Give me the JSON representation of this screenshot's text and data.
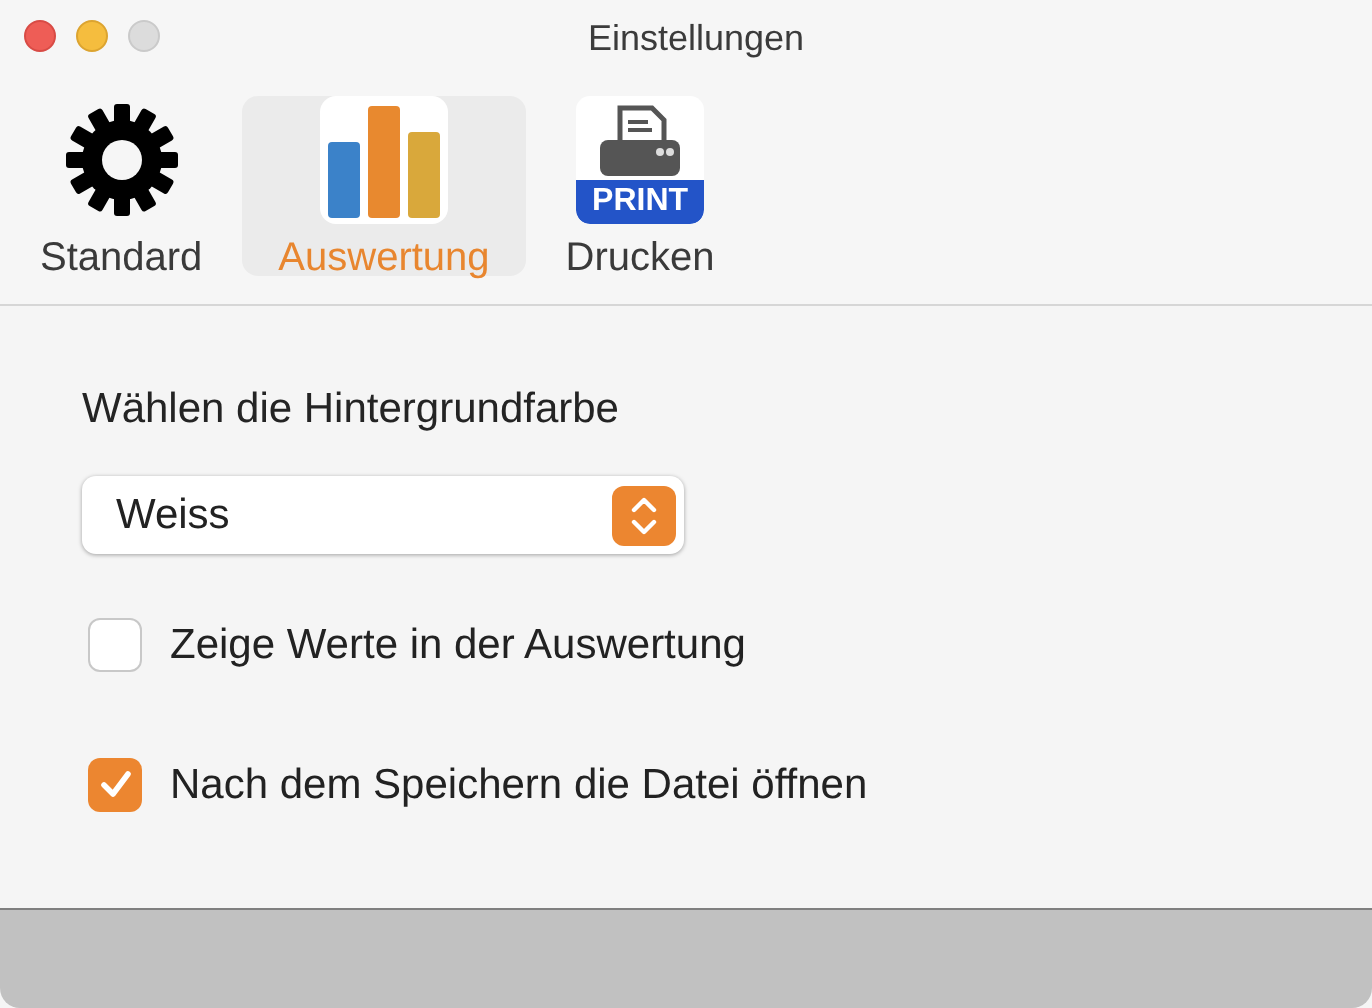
{
  "window": {
    "title": "Einstellungen"
  },
  "tabs": [
    {
      "label": "Standard",
      "kind": "gear",
      "selected": false
    },
    {
      "label": "Auswertung",
      "kind": "chart",
      "selected": true
    },
    {
      "label": "Drucken",
      "kind": "printer",
      "badge": "PRINT",
      "selected": false
    }
  ],
  "content": {
    "heading": "Wählen die Hintergrundfarbe",
    "popup": {
      "value": "Weiss"
    },
    "checkboxes": [
      {
        "label": "Zeige Werte in der Auswertung",
        "checked": false
      },
      {
        "label": "Nach dem Speichern die Datei öffnen",
        "checked": true
      }
    ]
  }
}
